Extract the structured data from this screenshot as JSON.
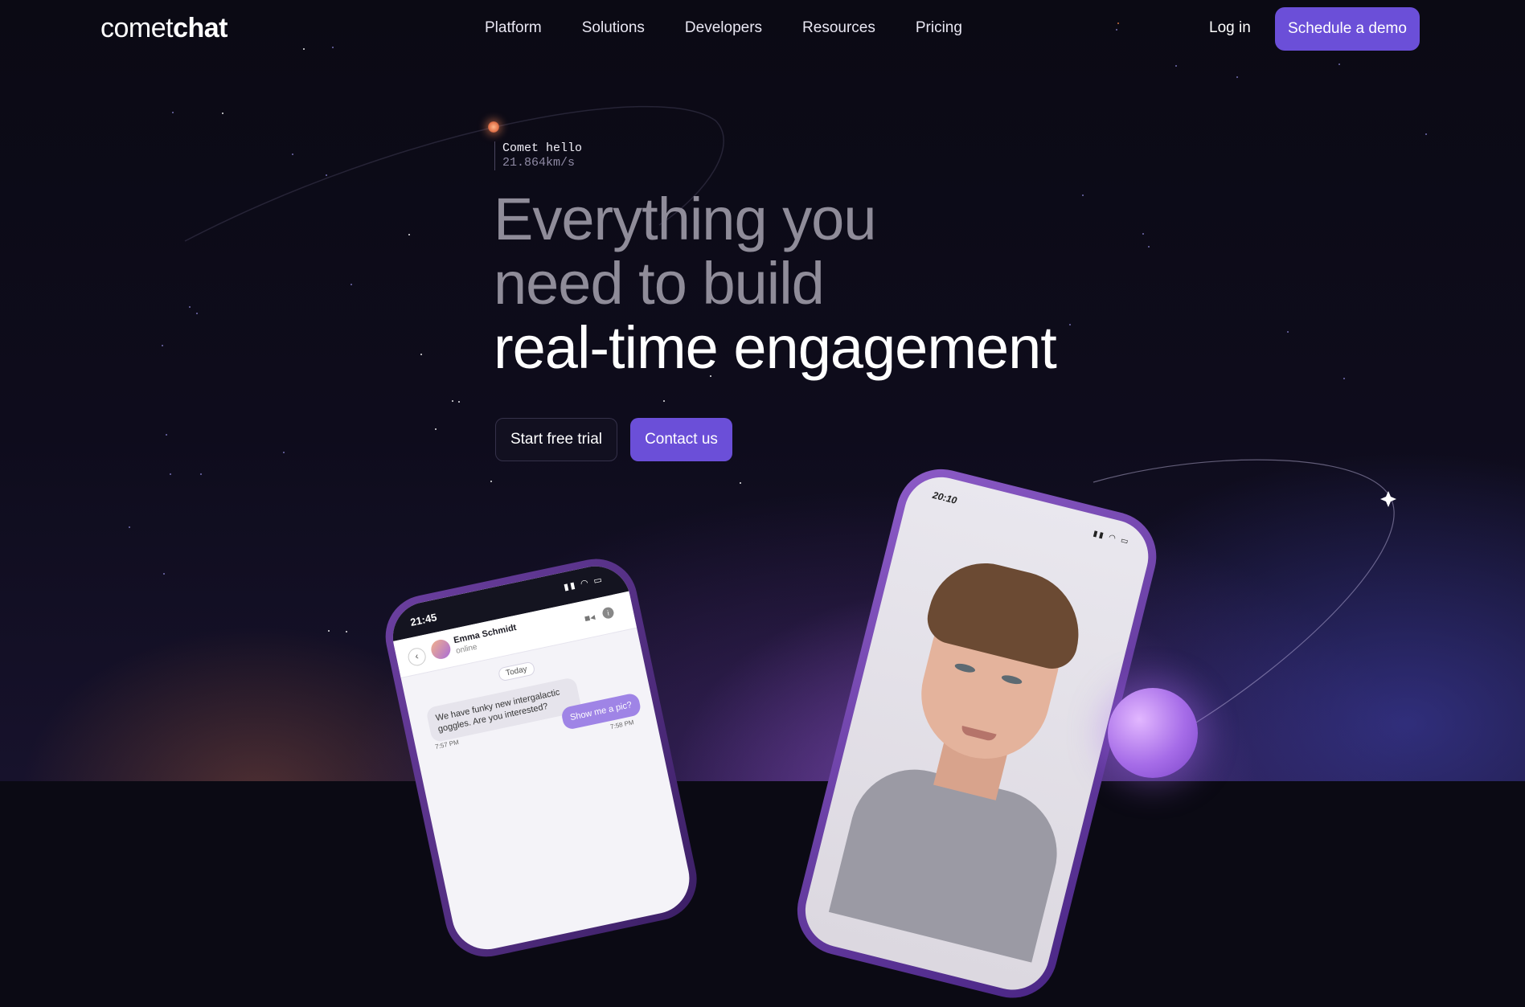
{
  "brand": {
    "logo_light": "comet",
    "logo_bold": "chat"
  },
  "nav": {
    "items": [
      "Platform",
      "Solutions",
      "Developers",
      "Resources",
      "Pricing"
    ],
    "login_label": "Log in",
    "demo_label": "Schedule a demo"
  },
  "comet": {
    "name": "Comet hello",
    "speed": "21.864km/s"
  },
  "hero": {
    "line1": "Everything you",
    "line2": "need to build",
    "line3": "real-time engagement"
  },
  "cta": {
    "trial_label": "Start free trial",
    "contact_label": "Contact us"
  },
  "chat_phone": {
    "time": "21:45",
    "contact_name": "Emma Schmidt",
    "contact_status": "online",
    "date_chip": "Today",
    "messages": [
      {
        "text": "We have funky new intergalactic goggles. Are you interested?",
        "time": "7:57 PM",
        "from": "contact"
      },
      {
        "text": "Show me a pic?",
        "time": "7:58 PM",
        "from": "me"
      }
    ]
  },
  "video_phone": {
    "time": "20:10"
  },
  "colors": {
    "accent": "#6b4fd8",
    "background": "#0b0a14"
  },
  "icons": [
    "back-icon",
    "video-call-icon",
    "info-icon",
    "signal-icon",
    "wifi-icon",
    "battery-icon",
    "sparkle-icon"
  ]
}
